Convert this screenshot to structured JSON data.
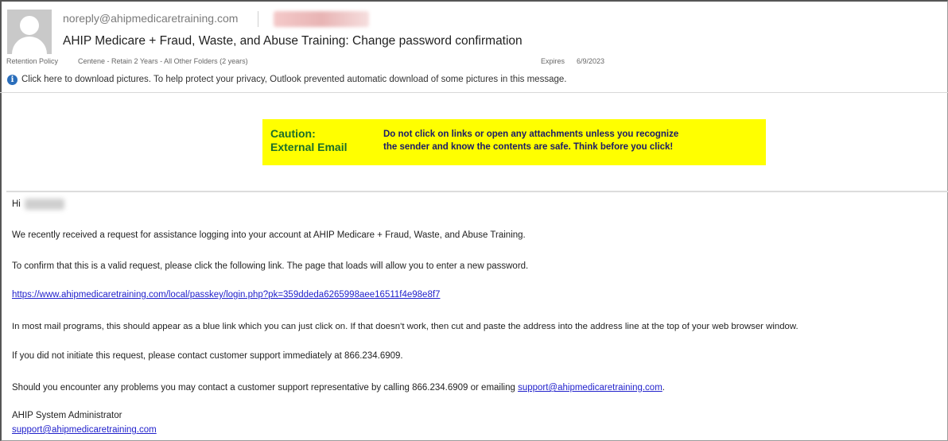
{
  "message": {
    "sender": "noreply@ahipmedicaretraining.com",
    "subject": "AHIP Medicare + Fraud, Waste, and Abuse Training: Change password confirmation",
    "retention_label": "Retention Policy",
    "retention_value": "Centene - Retain 2 Years - All Other Folders (2 years)",
    "expires_label": "Expires",
    "expires_value": "6/9/2023",
    "info_bar": "Click here to download pictures. To help protect your privacy, Outlook prevented automatic download of some pictures in this message."
  },
  "caution": {
    "title": "Caution:\nExternal Email",
    "text": "Do not click on links or open any attachments unless you recognize\nthe sender and know the contents are safe.  Think before you click!",
    "colors": {
      "background": "#ffff00",
      "title": "#1a6e2a",
      "text": "#1a1a6a"
    }
  },
  "body": {
    "greeting": "Hi",
    "p1": "We recently received a request for assistance logging into your account at AHIP Medicare + Fraud, Waste, and Abuse Training.",
    "p2": "To confirm that this is a valid request, please click the following link. The page that loads will allow you to enter a new password.",
    "reset_link": "https://www.ahipmedicaretraining.com/local/passkey/login.php?pk=359ddeda6265998aee16511f4e98e8f7",
    "p3": "In most mail programs, this should appear as a blue link which you can just click on. If that doesn't work, then cut and paste the address into the address line at the top of your web browser window.",
    "p4": "If you did not initiate this request, please contact customer support immediately at 866.234.6909.",
    "p5_prefix": "Should you encounter any problems you may contact a customer support representative by calling 866.234.6909 or emailing",
    "support_email": "support@ahipmedicaretraining.com",
    "p5_suffix": ".",
    "signature_name": "AHIP System Administrator",
    "signature_email": "support@ahipmedicaretraining.com"
  },
  "icons": {
    "avatar": "person-avatar-icon",
    "info": "info-icon"
  },
  "colors": {
    "link": "#2222cc",
    "info_icon": "#2a6ebb"
  }
}
